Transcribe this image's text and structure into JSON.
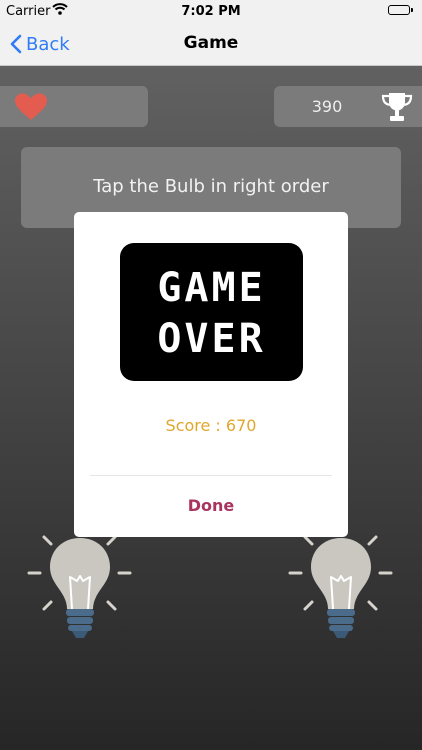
{
  "status_bar": {
    "carrier": "Carrier",
    "time": "7:02 PM"
  },
  "nav": {
    "back_label": "Back",
    "title": "Game"
  },
  "hud": {
    "score": "390"
  },
  "instruction": "Tap the Bulb in right order",
  "dialog": {
    "game_over_line1": "GAME",
    "game_over_line2": "OVER",
    "final_score": "Score : 670",
    "done_label": "Done"
  },
  "colors": {
    "heart": "#e35c4f",
    "accent_score": "#e0a72c",
    "done": "#a8345f",
    "back": "#2f7cf6"
  },
  "icons": [
    "wifi-icon",
    "battery-icon",
    "chevron-left-icon",
    "heart-icon",
    "trophy-icon",
    "lightbulb-icon"
  ]
}
